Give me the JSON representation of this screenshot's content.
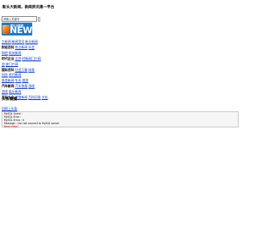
{
  "header": {
    "tagline": "新头大新闻，新闻资讯第一平台"
  },
  "search": {
    "placeholder": "请输入关键字",
    "value": "请输入关键字"
  },
  "logo": {
    "subtitle": "新头大新闻",
    "wordmark": "NEWS"
  },
  "nav": {
    "rows": [
      [
        "大新闻",
        "新闻资讯",
        "新头新闻"
      ],
      [
        "财经百科",
        "热点新闻",
        "社会"
      ],
      [
        "财经",
        "科技新闻"
      ],
      [
        "时代企业",
        "北京",
        "时新闻门户网"
      ],
      [
        "游",
        "旅门户网"
      ],
      [
        "国际百科",
        "社会万象",
        "体育"
      ],
      [
        "科技",
        "时代新闻"
      ],
      [
        "各类新闻",
        "车讯",
        "旅游"
      ],
      [
        "汽车新闻",
        "汽车快报",
        "游戏"
      ],
      [
        "游戏",
        "娱乐新闻"
      ],
      [
        "百科大全",
        "美食新闻",
        "百科问答",
        "文化"
      ]
    ]
  },
  "main": {
    "section_title": "头条概要",
    "home_link": "回顾上头条"
  },
  "error": {
    "lines": [
      "MySQL Query :",
      "MySQL Error :",
      "MySQL Errno : 0",
      "Message : Can not connect to MySQL server"
    ],
    "source": "Need Help?"
  },
  "colors": {
    "link": "#0033cc",
    "logo_bg": "#1e79c9",
    "error_src": "#cc0000"
  }
}
